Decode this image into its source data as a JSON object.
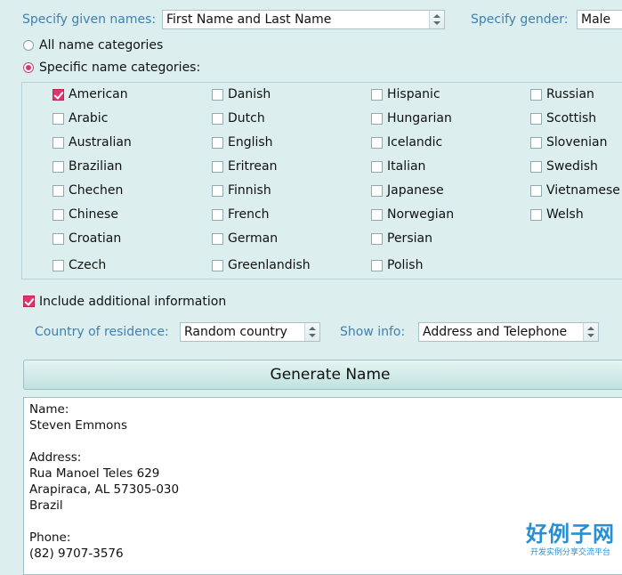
{
  "top": {
    "given_names_label": "Specify given names:",
    "given_names_value": "First Name and Last Name",
    "gender_label": "Specify gender:",
    "gender_value": "Male"
  },
  "categories_mode": {
    "all_label": "All name categories",
    "specific_label": "Specific name categories:",
    "selected": "specific"
  },
  "categories": {
    "col1": [
      {
        "label": "American",
        "checked": true
      },
      {
        "label": "Arabic",
        "checked": false
      },
      {
        "label": "Australian",
        "checked": false
      },
      {
        "label": "Brazilian",
        "checked": false
      },
      {
        "label": "Chechen",
        "checked": false
      },
      {
        "label": "Chinese",
        "checked": false
      },
      {
        "label": "Croatian",
        "checked": false
      },
      {
        "label": "Czech",
        "checked": false
      }
    ],
    "col2": [
      {
        "label": "Danish",
        "checked": false
      },
      {
        "label": "Dutch",
        "checked": false
      },
      {
        "label": "English",
        "checked": false
      },
      {
        "label": "Eritrean",
        "checked": false
      },
      {
        "label": "Finnish",
        "checked": false
      },
      {
        "label": "French",
        "checked": false
      },
      {
        "label": "German",
        "checked": false
      },
      {
        "label": "Greenlandish",
        "checked": false
      }
    ],
    "col3": [
      {
        "label": "Hispanic",
        "checked": false
      },
      {
        "label": "Hungarian",
        "checked": false
      },
      {
        "label": "Icelandic",
        "checked": false
      },
      {
        "label": "Italian",
        "checked": false
      },
      {
        "label": "Japanese",
        "checked": false
      },
      {
        "label": "Norwegian",
        "checked": false
      },
      {
        "label": "Persian",
        "checked": false
      },
      {
        "label": "Polish",
        "checked": false
      }
    ],
    "col4": [
      {
        "label": "Russian",
        "checked": false
      },
      {
        "label": "Scottish",
        "checked": false
      },
      {
        "label": "Slovenian",
        "checked": false
      },
      {
        "label": "Swedish",
        "checked": false
      },
      {
        "label": "Vietnamese",
        "checked": false
      },
      {
        "label": "Welsh",
        "checked": false
      }
    ]
  },
  "additional": {
    "include_label": "Include additional information",
    "include_checked": true,
    "country_label": "Country of residence:",
    "country_value": "Random country",
    "show_info_label": "Show info:",
    "show_info_value": "Address and Telephone"
  },
  "generate_button": "Generate Name",
  "output": {
    "lines": [
      "Name:",
      "Steven Emmons",
      "",
      "Address:",
      "Rua Manoel Teles 629",
      "Arapiraca, AL 57305-030",
      "Brazil",
      "",
      "Phone:",
      "(82) 9707-3576"
    ]
  },
  "watermark": {
    "title": "好例子网",
    "subtitle": "开发实例分享交流平台"
  },
  "colors": {
    "background": "#dcefee",
    "accent": "#e0356c",
    "label_blue": "#3f7fb3"
  }
}
